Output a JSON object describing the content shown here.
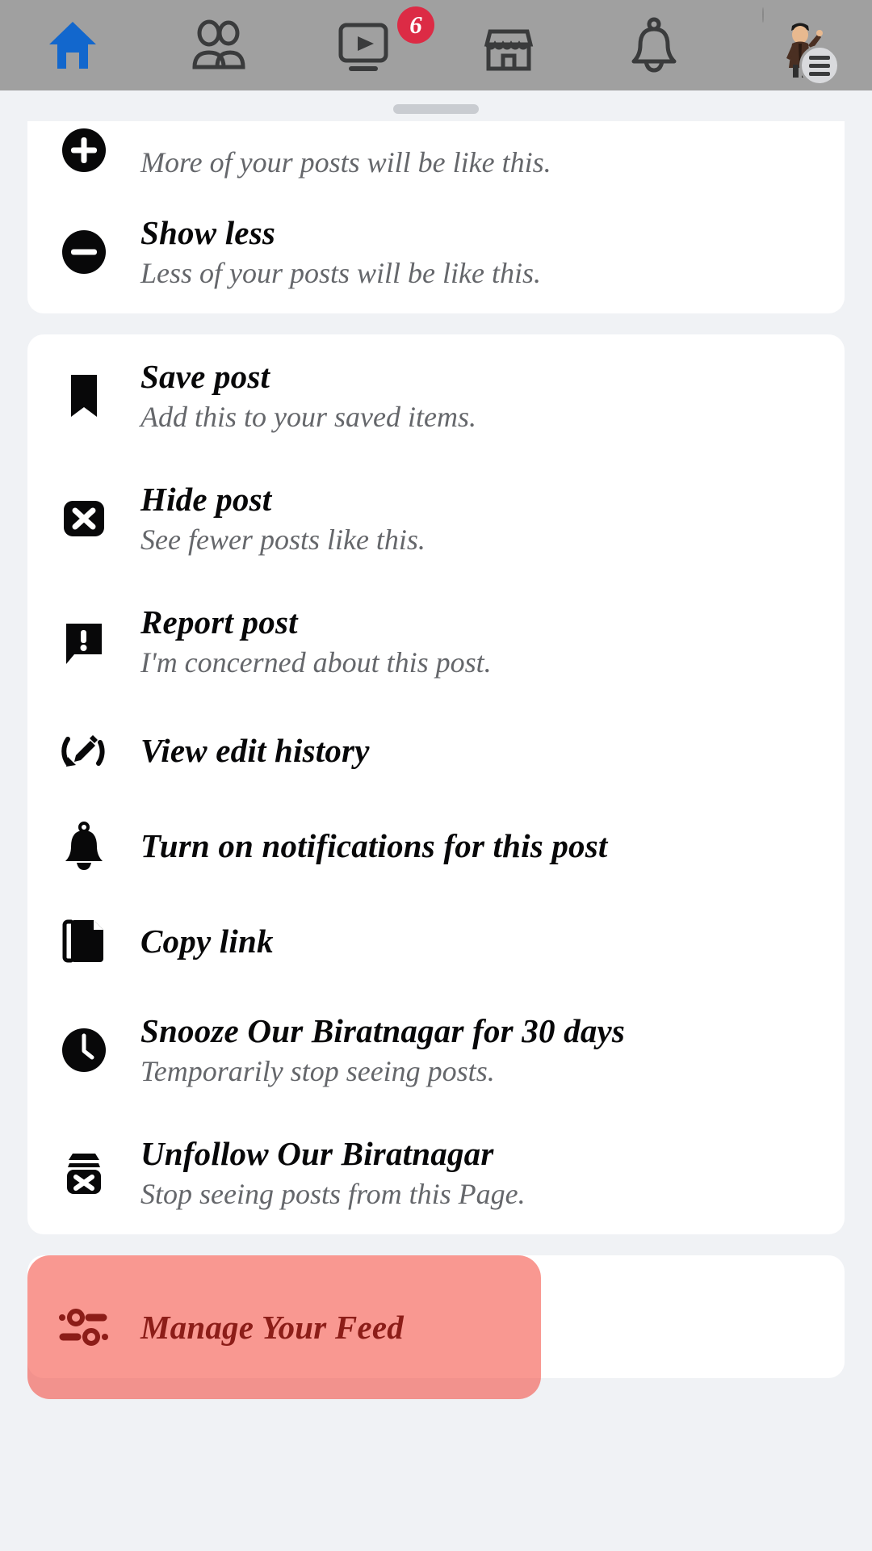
{
  "top_nav": {
    "tabs": [
      {
        "name": "home-tab",
        "icon": "home-icon",
        "active": true,
        "badge": ""
      },
      {
        "name": "friends-tab",
        "icon": "friends-icon",
        "active": false,
        "badge": ""
      },
      {
        "name": "video-tab",
        "icon": "video-icon",
        "active": false,
        "badge": "6"
      },
      {
        "name": "marketplace-tab",
        "icon": "marketplace-icon",
        "active": false,
        "badge": ""
      },
      {
        "name": "notifications-tab",
        "icon": "bell-icon",
        "active": false,
        "badge": ""
      },
      {
        "name": "menu-tab",
        "icon": "avatar-icon",
        "active": false,
        "badge": ""
      }
    ],
    "video_badge_count": "6",
    "active_color": "#1267cd",
    "inactive_color": "#3a3b3c",
    "bar_color": "#a0a0a0",
    "badge_color": "#dc2b45"
  },
  "sheet": {
    "handle": "drag-handle",
    "groups": [
      {
        "name": "feedback-group",
        "items": [
          {
            "key": "show-more",
            "icon": "plus-circle-icon",
            "title": "",
            "subtitle": "More of your posts will be like this.",
            "clipped": true
          },
          {
            "key": "show-less",
            "icon": "minus-circle-icon",
            "title": "Show less",
            "subtitle": "Less of your posts will be like this."
          }
        ]
      },
      {
        "name": "post-actions-group",
        "items": [
          {
            "key": "save-post",
            "icon": "bookmark-icon",
            "title": "Save post",
            "subtitle": "Add this to your saved items."
          },
          {
            "key": "hide-post",
            "icon": "hide-x-icon",
            "title": "Hide post",
            "subtitle": "See fewer posts like this."
          },
          {
            "key": "report-post",
            "icon": "report-warning-icon",
            "title": "Report post",
            "subtitle": "I'm concerned about this post."
          },
          {
            "key": "view-edit-history",
            "icon": "edit-history-icon",
            "title": "View edit history",
            "subtitle": ""
          },
          {
            "key": "turn-on-notifications",
            "icon": "bell-filled-icon",
            "title": "Turn on notifications for this post",
            "subtitle": ""
          },
          {
            "key": "copy-link",
            "icon": "copy-icon",
            "title": "Copy link",
            "subtitle": ""
          },
          {
            "key": "snooze-page",
            "icon": "clock-icon",
            "title": "Snooze Our Biratnagar for 30 days",
            "subtitle": "Temporarily stop seeing posts."
          },
          {
            "key": "unfollow-page",
            "icon": "unfollow-icon",
            "title": "Unfollow Our Biratnagar",
            "subtitle": "Stop seeing posts from this Page."
          }
        ]
      },
      {
        "name": "manage-feed-group",
        "items": [
          {
            "key": "manage-your-feed",
            "icon": "sliders-icon",
            "title": "Manage Your Feed",
            "subtitle": "",
            "highlighted": true,
            "highlight_color": "#f44336",
            "highlight_text_color": "#8c1d18"
          }
        ]
      }
    ]
  },
  "colors": {
    "sheet_background": "#f0f2f5",
    "card_background": "#ffffff",
    "title_text": "#080809",
    "subtitle_text": "#65676b",
    "handle": "#c9ccd1"
  }
}
